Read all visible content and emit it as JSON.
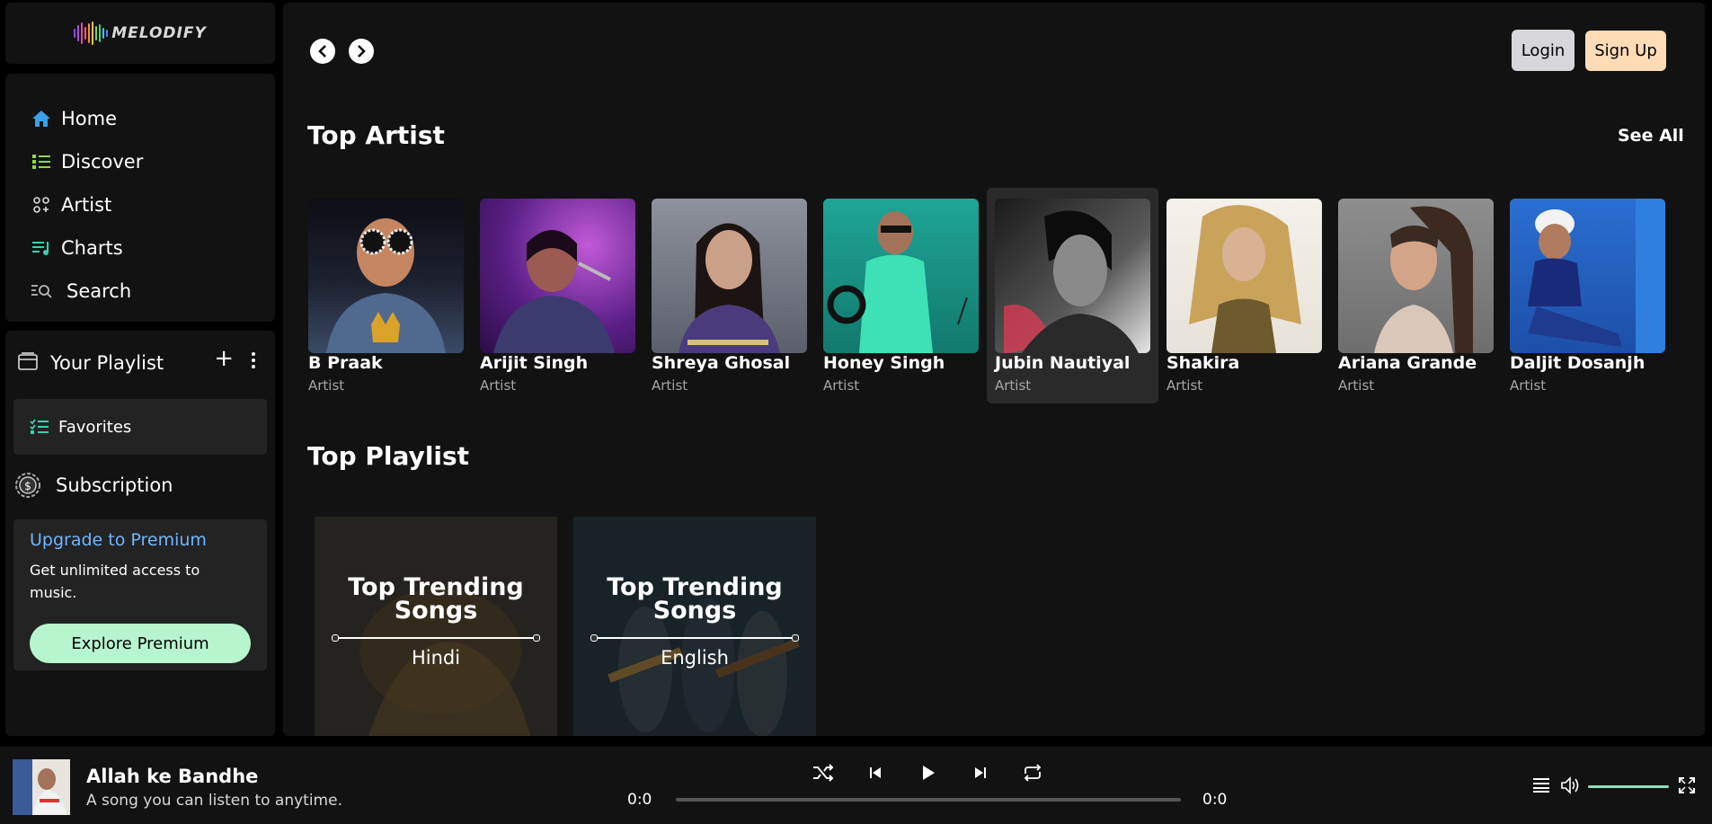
{
  "brand": {
    "name": "MELODIFY",
    "colors": [
      "#8e44ff",
      "#c04bd6",
      "#ff4f7e",
      "#ff8a3c",
      "#ffc83c",
      "#38d98a",
      "#3ac7ff",
      "#5f7bff"
    ]
  },
  "nav": [
    {
      "label": "Home",
      "icon": "home-icon"
    },
    {
      "label": "Discover",
      "icon": "list-icon"
    },
    {
      "label": "Artist",
      "icon": "artist-icon"
    },
    {
      "label": "Charts",
      "icon": "charts-icon"
    },
    {
      "label": "Search",
      "icon": "search-icon"
    }
  ],
  "library": {
    "title": "Your Playlist",
    "add": "+",
    "favorites": "Favorites",
    "subscription": "Subscription",
    "premium": {
      "title": "Upgrade to Premium",
      "text": "Get unlimited access to music.",
      "button": "Explore Premium"
    }
  },
  "header": {
    "login": "Login",
    "signup": "Sign Up"
  },
  "top_artist": {
    "title": "Top Artist",
    "see_all": "See All",
    "items": [
      {
        "name": "B Praak",
        "role": "Artist"
      },
      {
        "name": "Arijit Singh",
        "role": "Artist"
      },
      {
        "name": "Shreya Ghosal",
        "role": "Artist"
      },
      {
        "name": "Honey Singh",
        "role": "Artist"
      },
      {
        "name": "Jubin Nautiyal",
        "role": "Artist"
      },
      {
        "name": "Shakira",
        "role": "Artist"
      },
      {
        "name": "Ariana Grande",
        "role": "Artist"
      },
      {
        "name": "Daljit Dosanjh",
        "role": "Artist"
      }
    ]
  },
  "top_playlist": {
    "title": "Top Playlist",
    "items": [
      {
        "title": "Top Trending Songs",
        "lang": "Hindi"
      },
      {
        "title": "Top Trending Songs",
        "lang": "English"
      }
    ]
  },
  "player": {
    "title": "Allah ke Bandhe",
    "subtitle": "A song you can listen to anytime.",
    "time_current": "0:0",
    "time_total": "0:0",
    "progress": 0,
    "accent": "#8fe0b9"
  }
}
